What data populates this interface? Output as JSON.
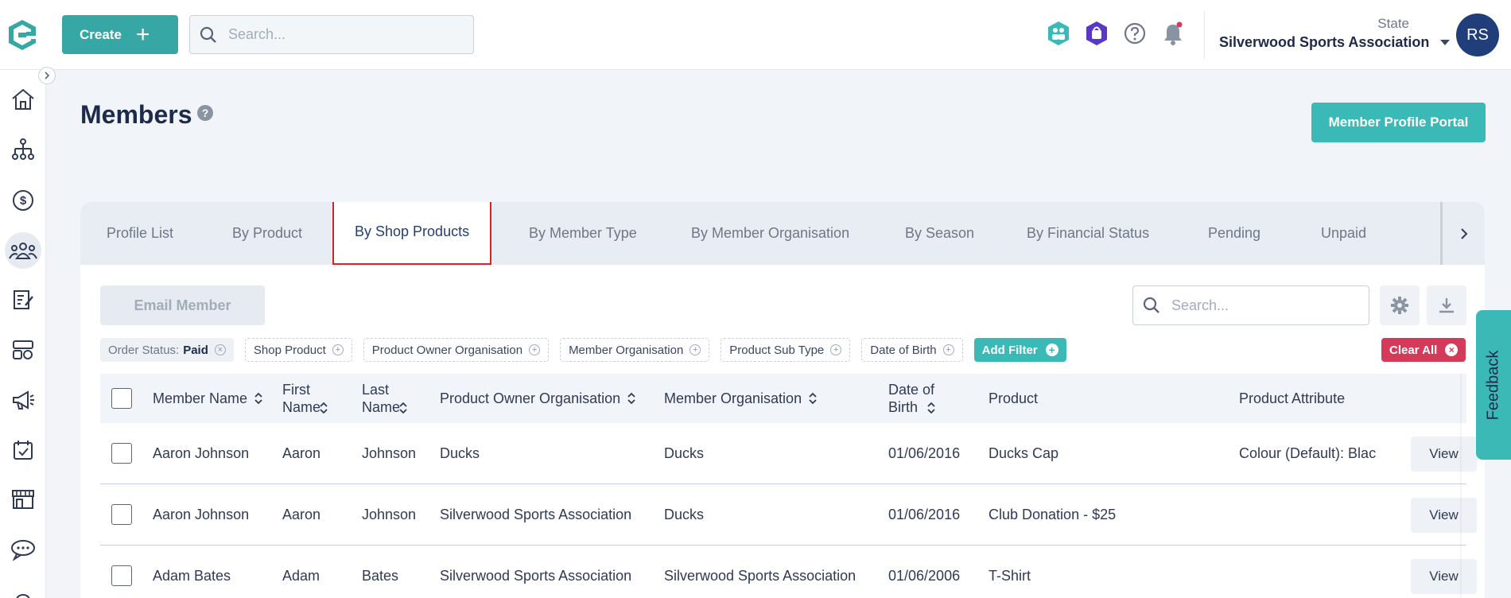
{
  "header": {
    "create_label": "Create",
    "search_placeholder": "Search...",
    "state_label": "State",
    "organisation": "Silverwood Sports Association",
    "avatar_initials": "RS"
  },
  "page": {
    "title": "Members",
    "portal_button": "Member Profile Portal"
  },
  "tabs": [
    {
      "label": "Profile List"
    },
    {
      "label": "By Product"
    },
    {
      "label": "By Shop Products"
    },
    {
      "label": "By Member Type"
    },
    {
      "label": "By Member Organisation"
    },
    {
      "label": "By Season"
    },
    {
      "label": "By Financial Status"
    },
    {
      "label": "Pending"
    },
    {
      "label": "Unpaid"
    }
  ],
  "toolbar": {
    "email_button": "Email Member",
    "search_placeholder": "Search..."
  },
  "filters": {
    "order_status_label": "Order Status:",
    "order_status_value": "Paid",
    "chips": [
      "Shop Product",
      "Product Owner Organisation",
      "Member Organisation",
      "Product Sub Type",
      "Date of Birth"
    ],
    "add_filter": "Add Filter",
    "clear_all": "Clear All"
  },
  "table": {
    "columns": {
      "member_name": "Member Name",
      "first_name": "First Name",
      "last_name": "Last Name",
      "owner_org": "Product Owner Organisation",
      "member_org": "Member Organisation",
      "dob": "Date of Birth",
      "product": "Product",
      "attribute": "Product Attribute"
    },
    "view_label": "View",
    "rows": [
      {
        "member_name": "Aaron Johnson",
        "first_name": "Aaron",
        "last_name": "Johnson",
        "owner_org": "Ducks",
        "member_org": "Ducks",
        "dob": "01/06/2016",
        "product": "Ducks Cap",
        "attribute": "Colour (Default): Blac"
      },
      {
        "member_name": "Aaron Johnson",
        "first_name": "Aaron",
        "last_name": "Johnson",
        "owner_org": "Silverwood Sports Association",
        "member_org": "Ducks",
        "dob": "01/06/2016",
        "product": "Club Donation - $25",
        "attribute": ""
      },
      {
        "member_name": "Adam Bates",
        "first_name": "Adam",
        "last_name": "Bates",
        "owner_org": "Silverwood Sports Association",
        "member_org": "Silverwood Sports Association",
        "dob": "01/06/2006",
        "product": "T-Shirt",
        "attribute": ""
      }
    ]
  },
  "feedback_label": "Feedback",
  "colors": {
    "primary": "#37a7a6",
    "accent": "#3ab9b6",
    "danger": "#d63a5a",
    "navy": "#1f3e7a"
  }
}
